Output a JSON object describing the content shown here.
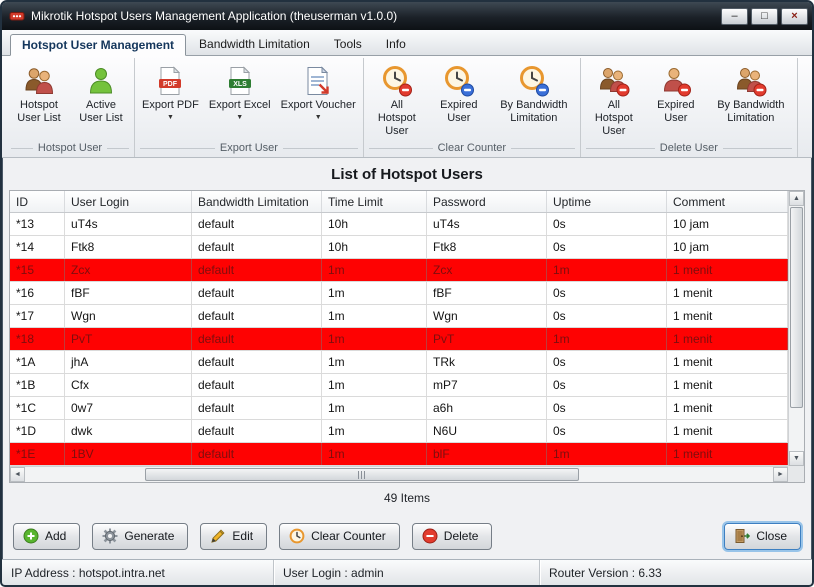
{
  "window": {
    "title": "Mikrotik Hotspot Users Management Application (theuserman v1.0.0)",
    "controls": {
      "minimize": "–",
      "maximize": "□",
      "close": "×"
    }
  },
  "tabs": [
    {
      "label": "Hotspot User Management",
      "active": true
    },
    {
      "label": "Bandwidth Limitation",
      "active": false
    },
    {
      "label": "Tools",
      "active": false
    },
    {
      "label": "Info",
      "active": false
    }
  ],
  "toolbar": {
    "groups": [
      {
        "label": "Hotspot User",
        "buttons": [
          {
            "label": "Hotspot User List",
            "icon": "hotspot-users-icon"
          },
          {
            "label": "Active User List",
            "icon": "active-user-icon"
          }
        ]
      },
      {
        "label": "Export User",
        "buttons": [
          {
            "label": "Export PDF",
            "icon": "pdf-file-icon",
            "dropdown": "▼"
          },
          {
            "label": "Export Excel",
            "icon": "excel-file-icon",
            "dropdown": "▼"
          },
          {
            "label": "Export Voucher",
            "icon": "voucher-file-icon",
            "dropdown": "▼"
          }
        ]
      },
      {
        "label": "Clear Counter",
        "buttons": [
          {
            "label": "All Hotspot User",
            "icon": "clock-minus-icon"
          },
          {
            "label": "Expired User",
            "icon": "clock-minus-icon"
          },
          {
            "label": "By Bandwidth Limitation",
            "icon": "clock-minus-icon"
          }
        ]
      },
      {
        "label": "Delete User",
        "buttons": [
          {
            "label": "All Hotspot User",
            "icon": "users-minus-icon"
          },
          {
            "label": "Expired User",
            "icon": "user-minus-icon"
          },
          {
            "label": "By Bandwidth Limitation",
            "icon": "users-minus-icon"
          }
        ]
      }
    ]
  },
  "main": {
    "heading": "List of Hotspot Users",
    "items_count": "49 Items"
  },
  "table": {
    "columns": [
      "ID",
      "User Login",
      "Bandwidth Limitation",
      "Time Limit",
      "Password",
      "Uptime",
      "Comment"
    ],
    "rows": [
      {
        "cells": [
          "*13",
          "uT4s",
          "default",
          "10h",
          "uT4s",
          "0s",
          "10 jam"
        ],
        "highlight": false
      },
      {
        "cells": [
          "*14",
          "Ftk8",
          "default",
          "10h",
          "Ftk8",
          "0s",
          "10 jam"
        ],
        "highlight": false
      },
      {
        "cells": [
          "*15",
          "Zcx",
          "default",
          "1m",
          "Zcx",
          "1m",
          "1 menit"
        ],
        "highlight": true
      },
      {
        "cells": [
          "*16",
          "fBF",
          "default",
          "1m",
          "fBF",
          "0s",
          "1 menit"
        ],
        "highlight": false
      },
      {
        "cells": [
          "*17",
          "Wgn",
          "default",
          "1m",
          "Wgn",
          "0s",
          "1 menit"
        ],
        "highlight": false
      },
      {
        "cells": [
          "*18",
          "PvT",
          "default",
          "1m",
          "PvT",
          "1m",
          "1 menit"
        ],
        "highlight": true
      },
      {
        "cells": [
          "*1A",
          "jhA",
          "default",
          "1m",
          "TRk",
          "0s",
          "1 menit"
        ],
        "highlight": false
      },
      {
        "cells": [
          "*1B",
          "Cfx",
          "default",
          "1m",
          "mP7",
          "0s",
          "1 menit"
        ],
        "highlight": false
      },
      {
        "cells": [
          "*1C",
          "0w7",
          "default",
          "1m",
          "a6h",
          "0s",
          "1 menit"
        ],
        "highlight": false
      },
      {
        "cells": [
          "*1D",
          "dwk",
          "default",
          "1m",
          "N6U",
          "0s",
          "1 menit"
        ],
        "highlight": false
      },
      {
        "cells": [
          "*1E",
          "1BV",
          "default",
          "1m",
          "blF",
          "1m",
          "1 menit"
        ],
        "highlight": true
      }
    ]
  },
  "actions": [
    {
      "label": "Add",
      "icon": "plus-circle-icon"
    },
    {
      "label": "Generate",
      "icon": "generate-gear-icon"
    },
    {
      "label": "Edit",
      "icon": "pencil-icon"
    },
    {
      "label": "Clear Counter",
      "icon": "clock-icon"
    },
    {
      "label": "Delete",
      "icon": "minus-circle-icon"
    }
  ],
  "close_button": {
    "label": "Close",
    "icon": "door-exit-icon"
  },
  "statusbar": {
    "ip": "IP Address : hotspot.intra.net",
    "user": "User Login : admin",
    "router": "Router Version : 6.33"
  },
  "colors": {
    "highlight_row_bg": "#fe0202",
    "highlight_row_text": "#7e0e0e",
    "titlebar_bg": "#1b2128",
    "default_button_ring": "#5da6e3"
  }
}
